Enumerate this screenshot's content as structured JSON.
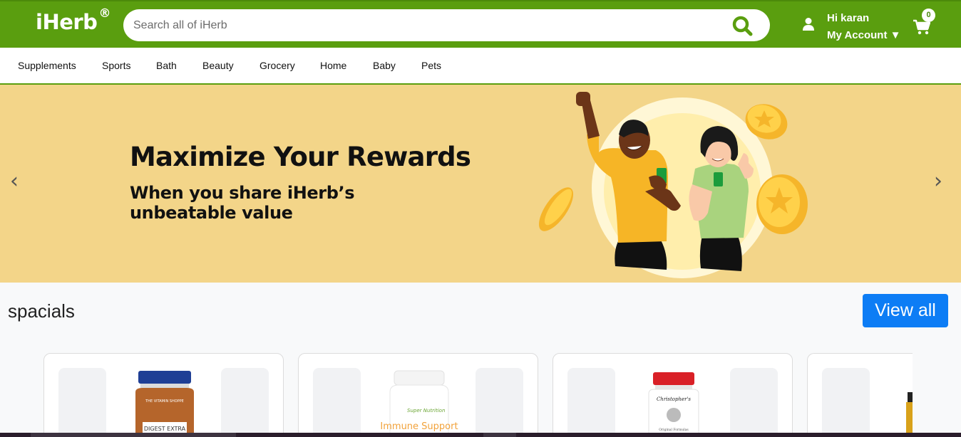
{
  "header": {
    "logo": "iHerb",
    "logo_mark": "®",
    "search_placeholder": "Search all of iHerb",
    "greeting": "Hi karan",
    "account_label": "My Account ▼",
    "cart_count": "0",
    "brand_color": "#5a9e0f"
  },
  "categories": [
    "Supplements",
    "Sports",
    "Bath",
    "Beauty",
    "Grocery",
    "Home",
    "Baby",
    "Pets"
  ],
  "banner": {
    "title": "Maximize Your Rewards",
    "subtitle": "When you share iHerb’s unbeatable value",
    "prev": "‹",
    "next": "›",
    "background": "#f3d589"
  },
  "specials": {
    "title": "spacials",
    "view_all": "View all",
    "products": [
      {
        "brand": "THE VITAMIN SHOPPE",
        "label": "DIGEST EXTRA",
        "cap_color": "#1f3f95",
        "body_color": "#b5652b"
      },
      {
        "brand": "Super Nutrition",
        "label": "Immune Support",
        "cap_color": "#ffffff",
        "body_color": "#ffffff"
      },
      {
        "brand": "Christopher's",
        "label": "Original Formulas",
        "cap_color": "#d92027",
        "body_color": "#ffffff"
      },
      {
        "brand": "",
        "label": "",
        "cap_color": "#222222",
        "body_color": "#d9a21a"
      }
    ]
  }
}
